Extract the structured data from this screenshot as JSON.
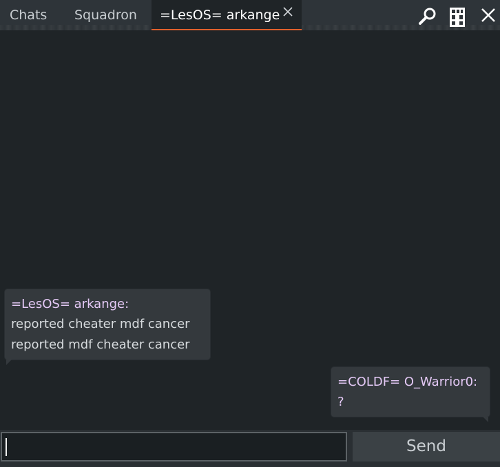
{
  "tabs": {
    "chats": "Chats",
    "squadron": "Squadron",
    "active": "=LesOS= arkange"
  },
  "toolbar": {
    "search_icon": "search-icon",
    "roster_icon": "roster-icon",
    "close_icon": "close-icon"
  },
  "messages": [
    {
      "sender": "=LesOS= arkange:",
      "lines": [
        "reported cheater mdf cancer",
        "reported mdf cheater cancer"
      ]
    },
    {
      "sender": "=COLDF= O_Warrior0:",
      "lines": [
        "?"
      ]
    }
  ],
  "input": {
    "value": "",
    "placeholder": ""
  },
  "send_label": "Send",
  "colors": {
    "background": "#1f2427",
    "sender_name": "#e4c9f6",
    "active_tab_underline": "#e0602c"
  }
}
